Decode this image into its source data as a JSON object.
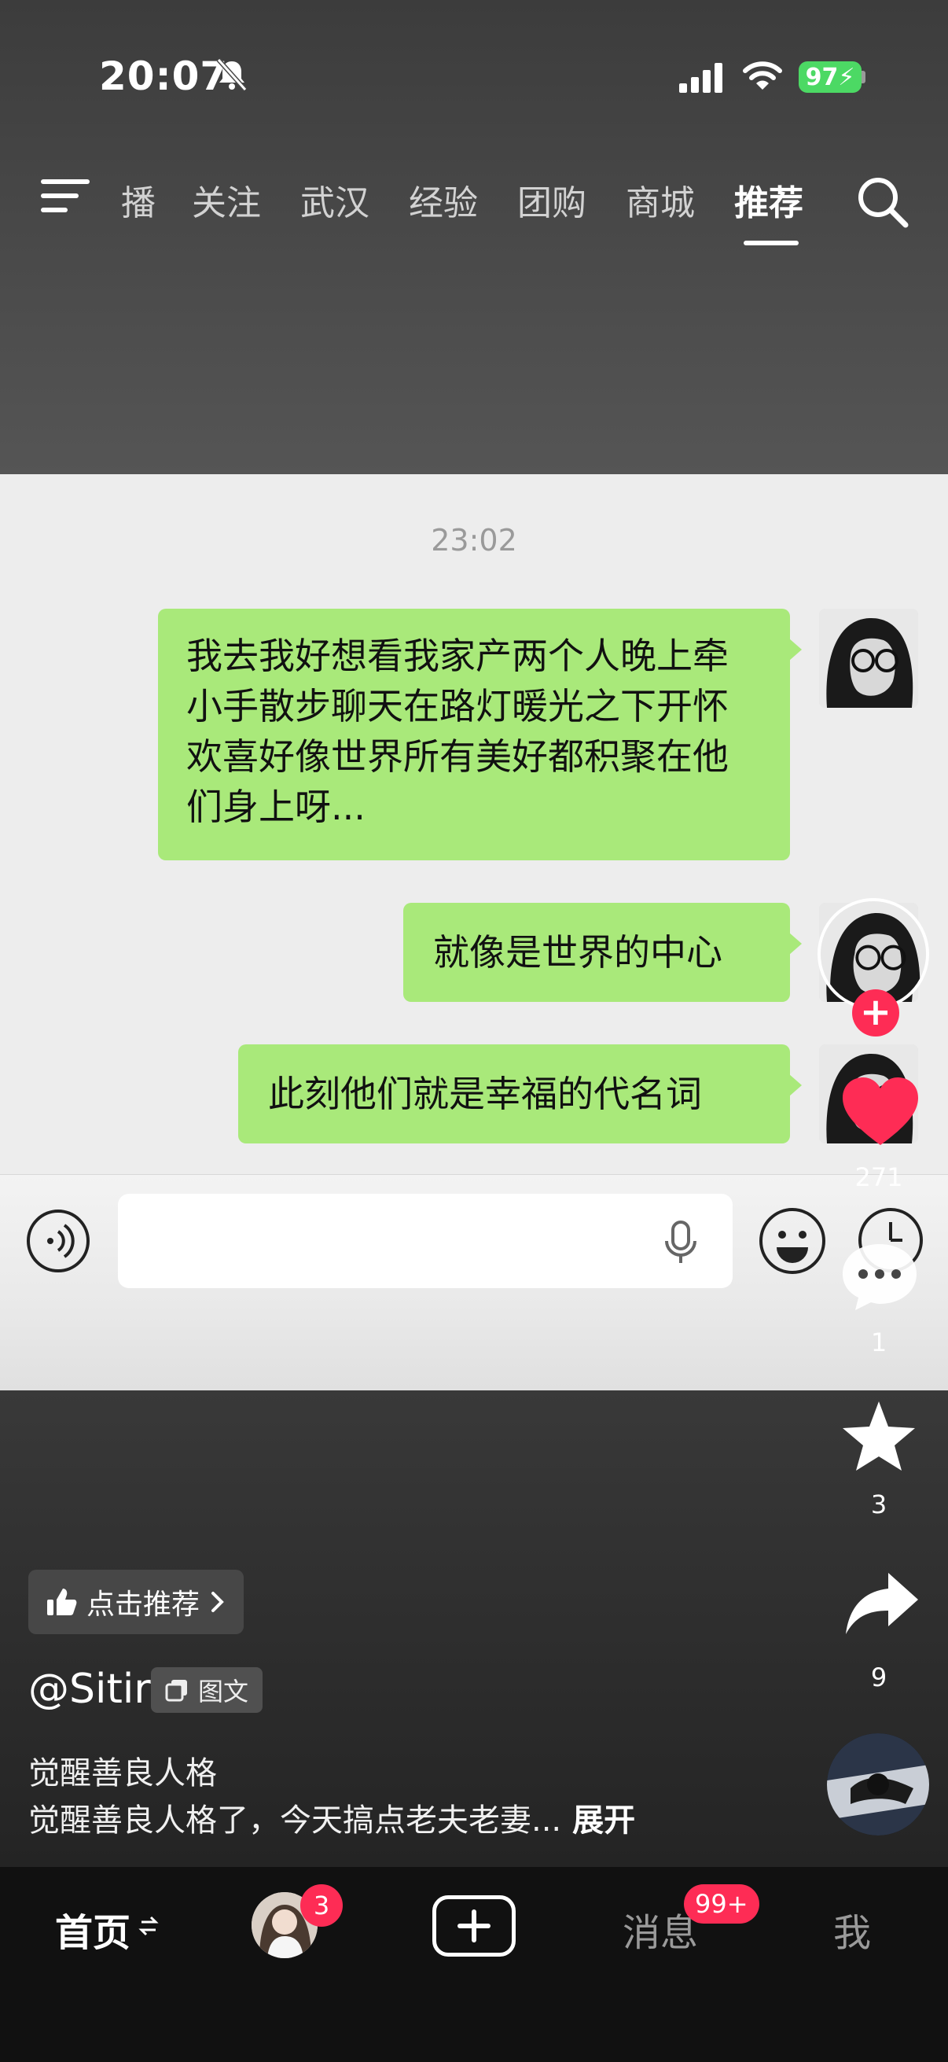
{
  "status_bar": {
    "time": "20:07",
    "battery": "97"
  },
  "top_tabs": [
    {
      "label": "播"
    },
    {
      "label": "关注"
    },
    {
      "label": "武汉"
    },
    {
      "label": "经验"
    },
    {
      "label": "团购"
    },
    {
      "label": "商城"
    },
    {
      "label": "推荐",
      "active": true
    }
  ],
  "chat": {
    "timestamp": "23:02",
    "messages": [
      {
        "text": "我去我好想看我家产两个人晚上牵小手散步聊天在路灯暖光之下开怀欢喜好像世界所有美好都积聚在他们身上呀..."
      },
      {
        "text": "就像是世界的中心"
      },
      {
        "text": "此刻他们就是幸福的代名词"
      }
    ],
    "input_placeholder": ""
  },
  "actions": {
    "likes": "271",
    "comments": "1",
    "favorites": "3",
    "shares": "9"
  },
  "post": {
    "recommend_label": "点击推荐",
    "author": "@Sitir",
    "type_badge": "图文",
    "title": "觉醒善良人格",
    "description": "觉醒善良人格了，今天搞点老夫老妻...",
    "expand_label": "展开"
  },
  "bottom_nav": {
    "home": "首页",
    "friend_badge": "3",
    "messages": "消息",
    "messages_badge": "99+",
    "me": "我"
  },
  "colors": {
    "bubble": "#a9e97a",
    "accent": "#fe2c55",
    "battery": "#4cd964"
  }
}
